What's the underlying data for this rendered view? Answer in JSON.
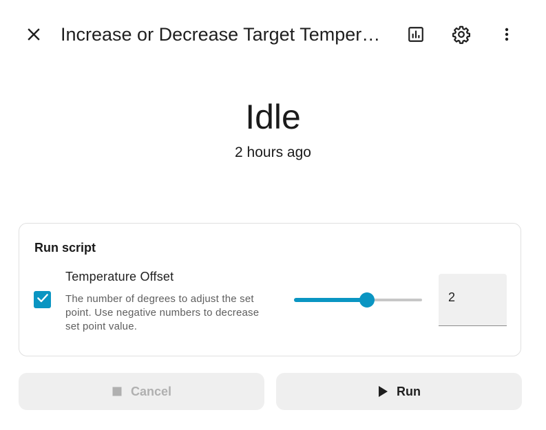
{
  "header": {
    "title": "Increase or Decrease Target Temperature",
    "icons": {
      "close": "close-icon",
      "history": "chart-bar-icon",
      "settings": "gear-icon",
      "more": "more-vertical-icon"
    }
  },
  "status": {
    "state": "Idle",
    "last_changed": "2 hours ago"
  },
  "run_card": {
    "title": "Run script",
    "field": {
      "enabled": true,
      "name": "Temperature Offset",
      "description": "The number of degrees to adjust the set point. Use negative numbers to decrease set point value.",
      "value": "2",
      "slider_fraction": 0.57
    }
  },
  "actions": {
    "cancel_label": "Cancel",
    "cancel_icon": "stop-icon",
    "run_label": "Run",
    "run_icon": "play-icon"
  },
  "colors": {
    "accent": "#0a95c2",
    "disabled_text": "#b0b0b0",
    "button_bg": "#efefef"
  }
}
